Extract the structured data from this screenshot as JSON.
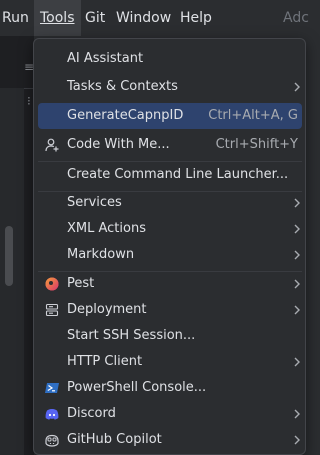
{
  "menubar": {
    "items": [
      {
        "label": "Run"
      },
      {
        "label": "Tools"
      },
      {
        "label": "Git"
      },
      {
        "label": "Window"
      },
      {
        "label": "Help"
      },
      {
        "label": "Adc"
      }
    ]
  },
  "menu": {
    "items": [
      {
        "label": "AI Assistant"
      },
      {
        "label": "Tasks & Contexts",
        "submenu": true
      },
      {
        "label": "GenerateCapnpID",
        "shortcut": "Ctrl+Alt+A, G",
        "selected": true
      },
      {
        "label": "Code With Me...",
        "shortcut": "Ctrl+Shift+Y",
        "icon": "person-add-icon"
      },
      {
        "label": "Create Command Line Launcher..."
      },
      {
        "label": "Services",
        "submenu": true
      },
      {
        "label": "XML Actions",
        "submenu": true
      },
      {
        "label": "Markdown",
        "submenu": true
      },
      {
        "label": "Pest",
        "submenu": true,
        "icon": "pest-icon"
      },
      {
        "label": "Deployment",
        "submenu": true,
        "icon": "deployment-icon"
      },
      {
        "label": "Start SSH Session..."
      },
      {
        "label": "HTTP Client",
        "submenu": true
      },
      {
        "label": "PowerShell Console...",
        "icon": "powershell-icon"
      },
      {
        "label": "Discord",
        "submenu": true,
        "icon": "discord-icon"
      },
      {
        "label": "GitHub Copilot",
        "submenu": true,
        "icon": "copilot-icon"
      }
    ]
  },
  "colors": {
    "menu_bg": "#2b2d30",
    "selection": "#2e436e",
    "text": "#dfe1e5",
    "shortcut": "#a8abb0"
  }
}
